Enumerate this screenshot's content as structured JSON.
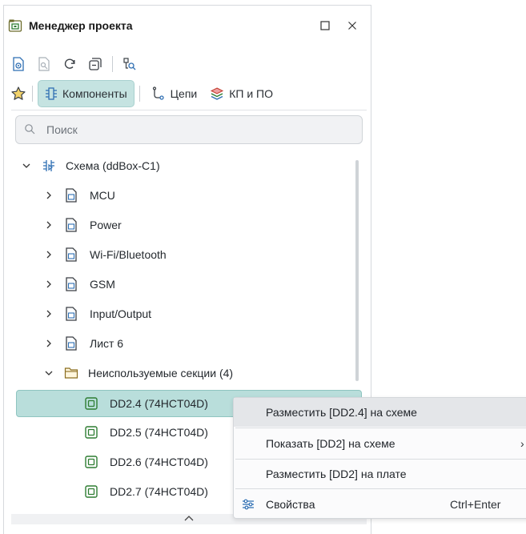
{
  "panel": {
    "title": "Менеджер проекта",
    "window_icons": [
      "project-manager-icon",
      "maximize-icon",
      "close-icon"
    ]
  },
  "toolbar": {
    "icons": [
      "open-document-icon",
      "find-disabled-icon",
      "refresh-icon",
      "collapse-all-icon",
      "find-in-tree-icon"
    ]
  },
  "tabs": {
    "favorites_icon": "star-icon",
    "items": [
      {
        "label": "Компоненты",
        "icon": "component-icon",
        "active": true
      },
      {
        "label": "Цепи",
        "icon": "net-icon",
        "active": false
      },
      {
        "label": "КП и ПО",
        "icon": "layers-icon",
        "active": false
      }
    ]
  },
  "search": {
    "placeholder": "Поиск"
  },
  "tree": {
    "root": "Схема (ddBox-C1)",
    "sheets": [
      "MCU",
      "Power",
      "Wi-Fi/Bluetooth",
      "GSM",
      "Input/Output",
      "Лист 6"
    ],
    "unused_folder": "Неиспользуемые секции (4)",
    "unused_items": [
      "DD2.4 (74HCT04D)",
      "DD2.5 (74HCT04D)",
      "DD2.6 (74HCT04D)",
      "DD2.7 (74HCT04D)"
    ]
  },
  "context_menu": {
    "items": [
      {
        "label": "Разместить [DD2.4] на схеме",
        "shortcut": ""
      },
      {
        "label": "Показать [DD2] на схеме",
        "shortcut": "›"
      },
      {
        "label": "Разместить [DD2] на плате",
        "shortcut": ""
      },
      {
        "label": "Свойства",
        "shortcut": "Ctrl+Enter"
      }
    ]
  },
  "colors": {
    "accent": "#c5e3e1",
    "selection": "#b9dedb",
    "icon_blue": "#2f6fb3",
    "icon_green": "#2e7d32"
  }
}
